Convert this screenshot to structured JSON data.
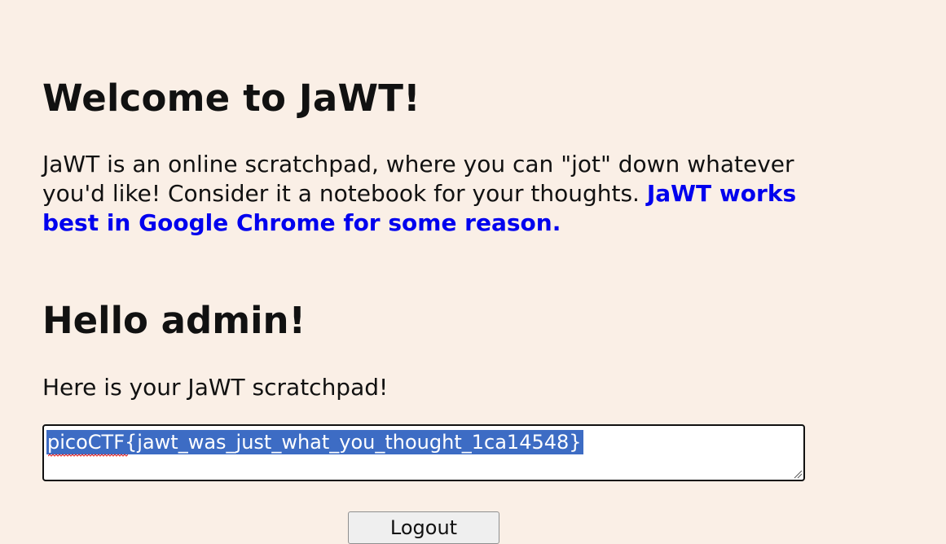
{
  "page": {
    "heading": "Welcome to JaWT!",
    "intro_text": " JaWT is an online scratchpad, where you can \"jot\" down whatever you'd like! Consider it a notebook for your thoughts. ",
    "intro_highlight": "JaWT works best in Google Chrome for some reason.",
    "greeting": "Hello admin!",
    "scratchpad_caption": " Here is your JaWT scratchpad!"
  },
  "scratchpad": {
    "value": "picoCTF{jawt_was_just_what_you_thought_1ca14548}",
    "text_selected": true,
    "spellcheck_flagged_word": "picoCTF"
  },
  "actions": {
    "logout_label": "Logout"
  },
  "colors": {
    "background": "#faefe6",
    "highlight_text": "#0000ee",
    "selection": "#3d6cc4",
    "spellcheck_underline": "#e02020"
  }
}
